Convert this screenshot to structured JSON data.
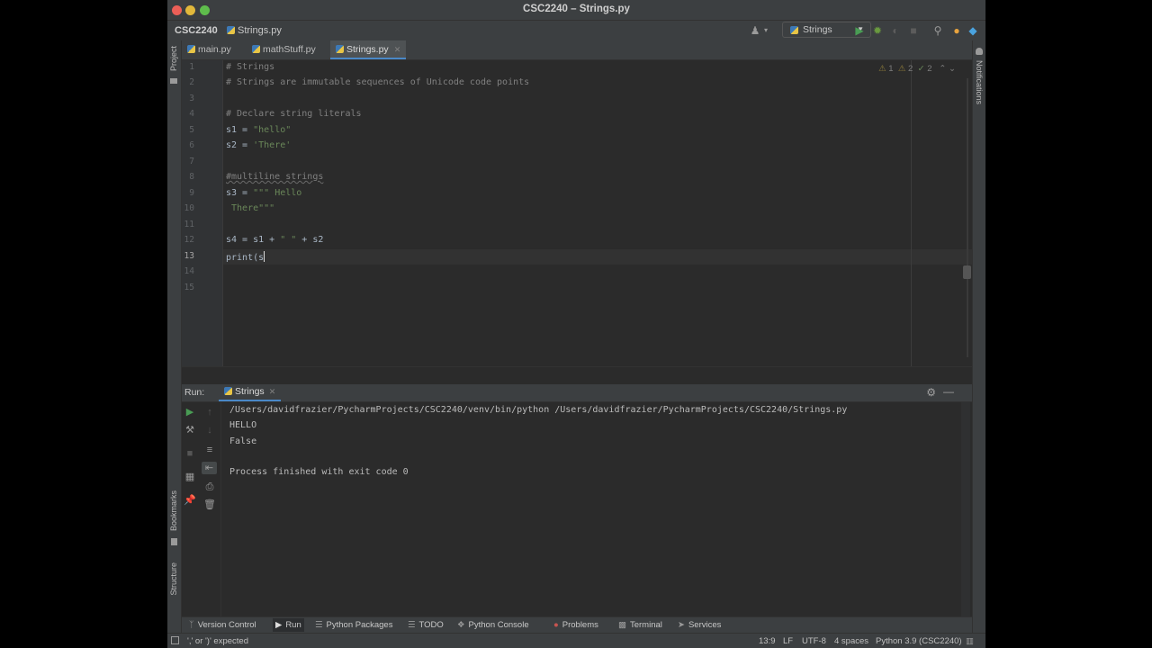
{
  "window": {
    "title": "CSC2240 – Strings.py"
  },
  "navbar": {
    "project": "CSC2240",
    "file": "Strings.py",
    "run_config": "Strings"
  },
  "tabs": [
    {
      "label": "main.py",
      "active": false
    },
    {
      "label": "mathStuff.py",
      "active": false
    },
    {
      "label": "Strings.py",
      "active": true
    }
  ],
  "left_strip": {
    "project": "Project",
    "bookmarks": "Bookmarks",
    "structure": "Structure"
  },
  "right_strip": {
    "notifications": "Notifications"
  },
  "editor": {
    "inspections": {
      "weak_warnings": "1",
      "warnings": "2",
      "typos": "2"
    },
    "current_line": 13,
    "line_numbers": [
      "1",
      "2",
      "3",
      "4",
      "5",
      "6",
      "7",
      "8",
      "9",
      "10",
      "11",
      "12",
      "13",
      "14",
      "15"
    ],
    "lines": [
      "# Strings",
      "# Strings are immutable sequences of Unicode code points",
      "",
      "# Declare string literals",
      "s1 = \"hello\"",
      "s2 = 'There'",
      "",
      "#multiline strings",
      "s3 = \"\"\" Hello",
      " There\"\"\"",
      "",
      "s4 = s1 + \" \" + s2",
      "print(s",
      "",
      ""
    ]
  },
  "run_panel": {
    "label": "Run:",
    "tab": "Strings",
    "output": [
      "/Users/davidfrazier/PycharmProjects/CSC2240/venv/bin/python /Users/davidfrazier/PycharmProjects/CSC2240/Strings.py",
      "HELLO",
      "False",
      "",
      "Process finished with exit code 0"
    ]
  },
  "bottom_tools": [
    {
      "label": "Version Control",
      "icon": "branch-icon"
    },
    {
      "label": "Run",
      "icon": "play-icon",
      "active": true
    },
    {
      "label": "Python Packages",
      "icon": "layers-icon"
    },
    {
      "label": "TODO",
      "icon": "list-icon"
    },
    {
      "label": "Python Console",
      "icon": "python-icon"
    },
    {
      "label": "Problems",
      "icon": "problems-icon"
    },
    {
      "label": "Terminal",
      "icon": "terminal-icon"
    },
    {
      "label": "Services",
      "icon": "services-icon"
    }
  ],
  "status": {
    "message": "',' or ')' expected",
    "position": "13:9",
    "line_sep": "LF",
    "encoding": "UTF-8",
    "indent": "4 spaces",
    "interpreter": "Python 3.9 (CSC2240)"
  },
  "colors": {
    "background": "#2b2b2b",
    "chrome": "#3c3f41",
    "accent": "#4a88c7",
    "comment": "#808080",
    "string": "#6a8759",
    "run_green": "#499c54"
  }
}
